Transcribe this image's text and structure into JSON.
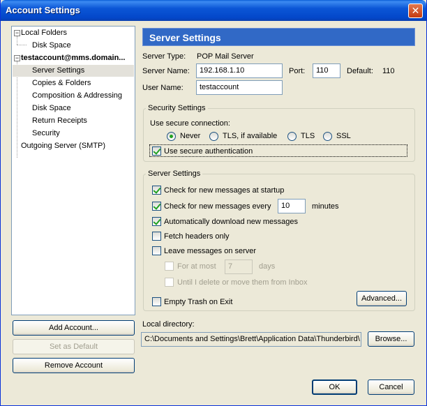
{
  "window": {
    "title": "Account Settings",
    "close_glyph": "✕"
  },
  "tree": {
    "items": [
      {
        "label": "Local Folders",
        "bold": false,
        "selected": false
      },
      {
        "label": "Disk Space",
        "bold": false,
        "selected": false
      },
      {
        "label": "testaccount@mms.domain...",
        "bold": true,
        "selected": false
      },
      {
        "label": "Server Settings",
        "bold": false,
        "selected": true
      },
      {
        "label": "Copies & Folders",
        "bold": false,
        "selected": false
      },
      {
        "label": "Composition & Addressing",
        "bold": false,
        "selected": false
      },
      {
        "label": "Disk Space",
        "bold": false,
        "selected": false
      },
      {
        "label": "Return Receipts",
        "bold": false,
        "selected": false
      },
      {
        "label": "Security",
        "bold": false,
        "selected": false
      },
      {
        "label": "Outgoing Server (SMTP)",
        "bold": false,
        "selected": false
      }
    ],
    "expander_glyph": "−"
  },
  "left_buttons": {
    "add_account": "Add Account...",
    "set_default": "Set as Default",
    "remove_account": "Remove Account"
  },
  "panel": {
    "header": "Server Settings",
    "server_type_label": "Server Type:",
    "server_type_value": "POP Mail Server",
    "server_name_label": "Server Name:",
    "server_name_value": "192.168.1.10",
    "port_label": "Port:",
    "port_value": "110",
    "default_label": "Default:",
    "default_value": "110",
    "user_name_label": "User Name:",
    "user_name_value": "testaccount"
  },
  "security": {
    "title": "Security Settings",
    "use_secure_label": "Use secure connection:",
    "options": [
      "Never",
      "TLS, if available",
      "TLS",
      "SSL"
    ],
    "selected": "Never",
    "secure_auth_label": "Use secure authentication",
    "secure_auth_checked": true
  },
  "server_settings": {
    "title": "Server Settings",
    "check_startup_label": "Check for new messages at startup",
    "check_startup": true,
    "check_every_label": "Check for new messages every",
    "check_every": true,
    "check_every_value": "10",
    "minutes_label": "minutes",
    "auto_download_label": "Automatically download new messages",
    "auto_download": true,
    "fetch_headers_label": "Fetch headers only",
    "fetch_headers": false,
    "leave_messages_label": "Leave messages on server",
    "leave_messages": false,
    "for_at_most_label": "For at most",
    "for_at_most_value": "7",
    "days_label": "days",
    "until_delete_label": "Until I delete or move them from Inbox",
    "advanced_button": "Advanced...",
    "empty_trash_label": "Empty Trash on Exit",
    "empty_trash": false
  },
  "local_directory": {
    "label": "Local directory:",
    "value": "C:\\Documents and Settings\\Brett\\Application Data\\Thunderbird\\",
    "browse_button": "Browse..."
  },
  "dialog_buttons": {
    "ok": "OK",
    "cancel": "Cancel"
  },
  "colors": {
    "accent": "#3169c6",
    "titlebar": "#0b56d6",
    "check": "#21a121"
  }
}
